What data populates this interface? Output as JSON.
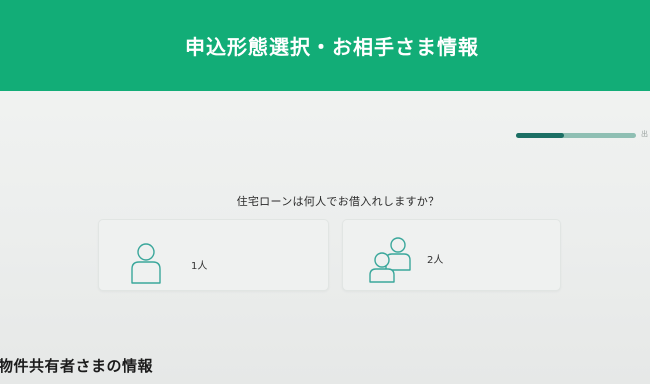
{
  "header": {
    "title": "申込形態選択・お相手さま情報"
  },
  "progress": {
    "value": 0.4,
    "step_label": "出"
  },
  "question": {
    "text": "住宅ローンは何人でお借入れしますか？"
  },
  "options": [
    {
      "label": "1人",
      "icon": "single-person-icon"
    },
    {
      "label": "2人",
      "icon": "two-people-icon"
    }
  ],
  "section": {
    "title": "物件共有者さまの情報"
  },
  "colors": {
    "header": "#12ad77",
    "icon_stroke": "#3aa79b",
    "progress_fill": "#1c6f64",
    "progress_track": "#8fbfb3"
  }
}
